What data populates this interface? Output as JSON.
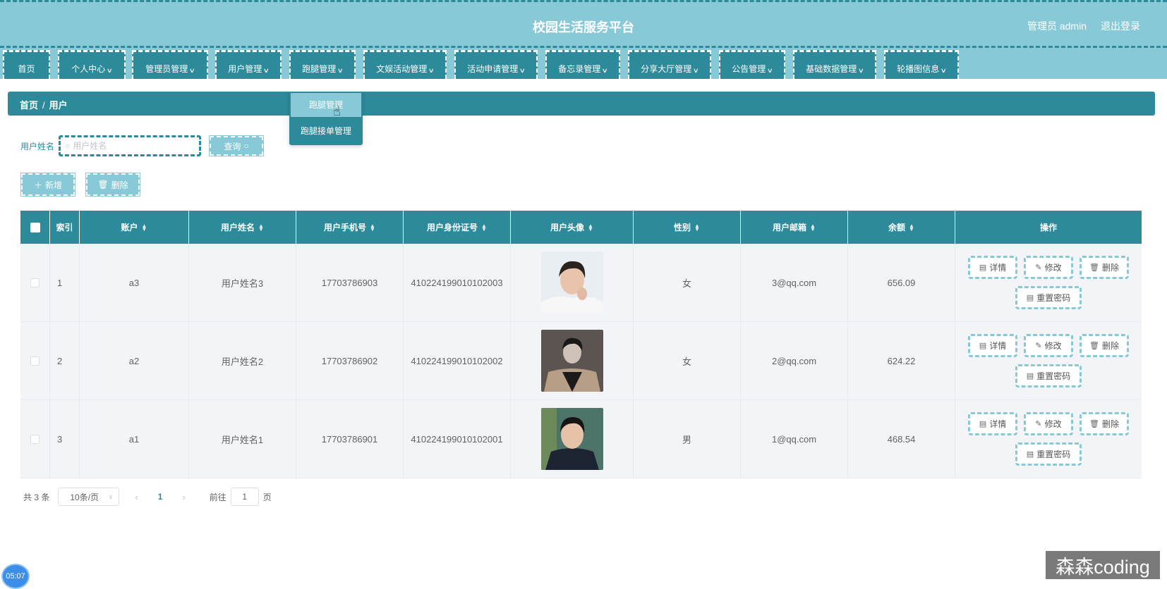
{
  "app": {
    "title": "校园生活服务平台",
    "user_label": "管理员 admin",
    "logout": "退出登录"
  },
  "nav": [
    {
      "label": "首页",
      "has_menu": false
    },
    {
      "label": "个人中心",
      "has_menu": true
    },
    {
      "label": "管理员管理",
      "has_menu": true
    },
    {
      "label": "用户管理",
      "has_menu": true
    },
    {
      "label": "跑腿管理",
      "has_menu": true
    },
    {
      "label": "文娱活动管理",
      "has_menu": true
    },
    {
      "label": "活动申请管理",
      "has_menu": true
    },
    {
      "label": "备忘录管理",
      "has_menu": true
    },
    {
      "label": "分享大厅管理",
      "has_menu": true
    },
    {
      "label": "公告管理",
      "has_menu": true
    },
    {
      "label": "基础数据管理",
      "has_menu": true
    },
    {
      "label": "轮播图信息",
      "has_menu": true
    }
  ],
  "dropdown": {
    "items": [
      "跑腿管理",
      "跑腿接单管理"
    ],
    "hovered_index": 0
  },
  "breadcrumb": {
    "home": "首页",
    "separator": "/",
    "current": "用户"
  },
  "search": {
    "label": "用户姓名",
    "placeholder": "用户姓名",
    "value": "",
    "query_button": "查询"
  },
  "actions": {
    "add": "新增",
    "delete": "删除"
  },
  "table": {
    "columns": [
      "索引",
      "账户",
      "用户姓名",
      "用户手机号",
      "用户身份证号",
      "用户头像",
      "性别",
      "用户邮箱",
      "余额",
      "操作"
    ],
    "rows": [
      {
        "index": "1",
        "account": "a3",
        "name": "用户姓名3",
        "phone": "17703786903",
        "id_card": "410224199010102003",
        "avatar": "avatar-photo-1",
        "gender": "女",
        "email": "3@qq.com",
        "balance": "656.09"
      },
      {
        "index": "2",
        "account": "a2",
        "name": "用户姓名2",
        "phone": "17703786902",
        "id_card": "410224199010102002",
        "avatar": "avatar-photo-2",
        "gender": "女",
        "email": "2@qq.com",
        "balance": "624.22"
      },
      {
        "index": "3",
        "account": "a1",
        "name": "用户姓名1",
        "phone": "17703786901",
        "id_card": "410224199010102001",
        "avatar": "avatar-photo-3",
        "gender": "男",
        "email": "1@qq.com",
        "balance": "468.54"
      }
    ],
    "row_ops": {
      "detail": "详情",
      "edit": "修改",
      "delete": "删除",
      "reset": "重置密码"
    }
  },
  "pager": {
    "total": "共 3 条",
    "page_size": "10条/页",
    "current_page": "1",
    "goto_prefix": "前往",
    "goto_value": "1",
    "goto_suffix": "页"
  },
  "overlay": {
    "timer": "05:07",
    "watermark": "森森coding"
  },
  "colors": {
    "primary": "#2d8a9a",
    "light": "#88c9d8"
  }
}
